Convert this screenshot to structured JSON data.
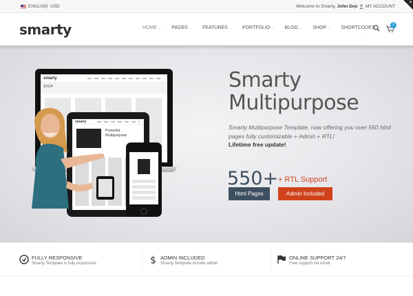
{
  "topbar": {
    "language": "ENGLISH",
    "currency": "USD",
    "welcome_prefix": "Welcome to Smarty,",
    "user_name": "John Doe",
    "account_label": "MY ACCOUNT"
  },
  "header": {
    "logo": "smarty",
    "nav": [
      {
        "label": "HOME"
      },
      {
        "label": "PAGES"
      },
      {
        "label": "FEATURES"
      },
      {
        "label": "PORTFOLIO"
      },
      {
        "label": "BLOG"
      },
      {
        "label": "SHOP"
      },
      {
        "label": "SHORTCODES"
      }
    ],
    "cart_count": "2",
    "accent_color": "#2a9fd6"
  },
  "hero": {
    "title_line1": "Smarty",
    "title_line2": "Multipurpose",
    "description": "Smarty Multipurpose Template, now offering you over 550 html pages fully customizable + Admin + RTL!",
    "lifetime": "Lifetime free update!",
    "big_number": "550+",
    "rtl_label": "+ RTL Support",
    "badge_pages": "Html Pages",
    "badge_admin": "Admin Included",
    "colors": {
      "dark": "#3d4f60",
      "red": "#d0421b"
    }
  },
  "mockups": {
    "laptop_logo": "smarty",
    "laptop_page": "SHOP",
    "tablet_logo": "smarty",
    "tablet_heading_line1": "Powerful",
    "tablet_heading_line2": "Multipurpose"
  },
  "features": [
    {
      "icon": "responsive-icon",
      "title": "FULLY RESPONSIVE",
      "subtitle": "Smarty Template is fully responsive"
    },
    {
      "icon": "dollar-icon",
      "title": "ADMIN INCLUDED",
      "subtitle": "Smarty Template include admin"
    },
    {
      "icon": "flag-icon",
      "title": "ONLINE SUPPORT 24/7",
      "subtitle": "Free support via email"
    }
  ]
}
